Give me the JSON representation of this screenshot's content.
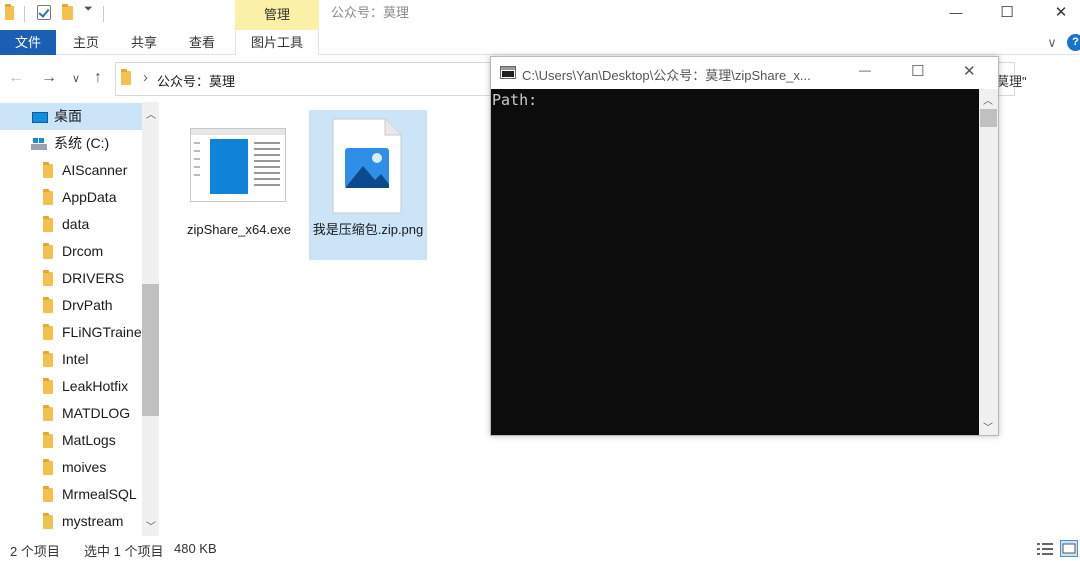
{
  "titlebar": {
    "ribbon_context": "管理",
    "window_title": "公众号：莫理",
    "minimize": "—",
    "maximize": "☐",
    "close": "✕"
  },
  "ribbon": {
    "tabs": [
      {
        "label": "文件"
      },
      {
        "label": "主页"
      },
      {
        "label": "共享"
      },
      {
        "label": "查看"
      },
      {
        "label": "图片工具"
      }
    ],
    "expand": "∨",
    "help": "?"
  },
  "address": {
    "back": "←",
    "forward": "→",
    "recent": "∨",
    "up": "↑",
    "chevron": "›",
    "path": "公众号：莫理",
    "search_placeholder": "莫理\""
  },
  "nav": {
    "items": [
      {
        "label": "桌面"
      },
      {
        "label": "系统 (C:)"
      },
      {
        "label": "AIScanner"
      },
      {
        "label": "AppData"
      },
      {
        "label": "data"
      },
      {
        "label": "Drcom"
      },
      {
        "label": "DRIVERS"
      },
      {
        "label": "DrvPath"
      },
      {
        "label": "FLiNGTrainer"
      },
      {
        "label": "Intel"
      },
      {
        "label": "LeakHotfix"
      },
      {
        "label": "MATDLOG"
      },
      {
        "label": "MatLogs"
      },
      {
        "label": "moives"
      },
      {
        "label": "MrmealSQL"
      },
      {
        "label": "mystream"
      }
    ]
  },
  "files": [
    {
      "name": "zipShare_x64.exe"
    },
    {
      "name": "我是压缩包.zip.png"
    }
  ],
  "console": {
    "title": "C:\\Users\\Yan\\Desktop\\公众号：莫理\\zipShare_x...",
    "minimize": "—",
    "maximize": "☐",
    "close": "✕",
    "output": "Path:"
  },
  "status": {
    "count": "2 个项目",
    "selection": "选中 1 个项目",
    "size": "480 KB"
  },
  "colors": {
    "accent": "#1a5fb4",
    "selection": "#cce4f7",
    "context_tab": "#fbf0a8",
    "console_bg": "#0c0c0c"
  }
}
